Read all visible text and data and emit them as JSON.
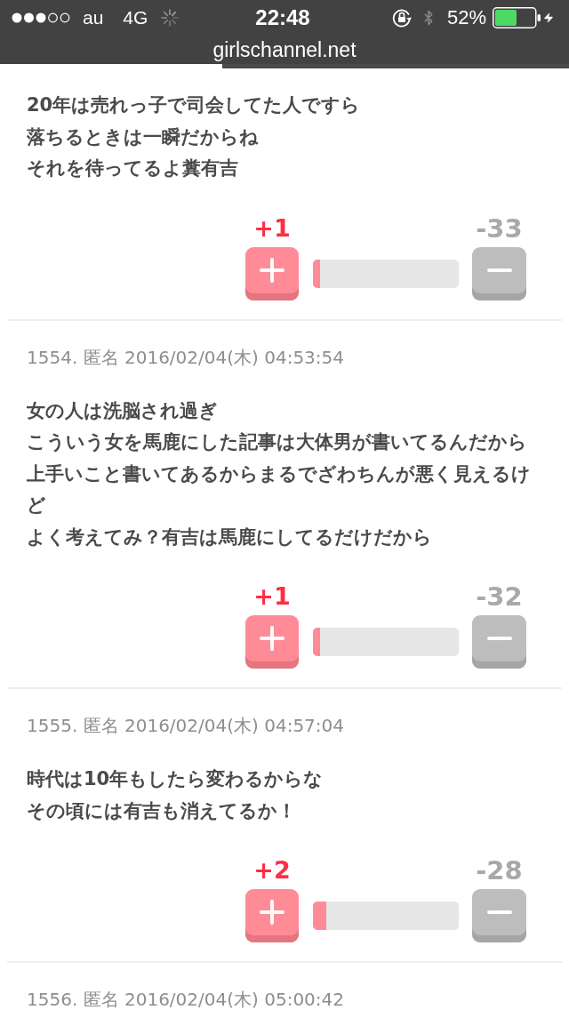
{
  "status_bar": {
    "carrier": "au",
    "network": "4G",
    "time": "22:48",
    "battery": "52%"
  },
  "address_bar": {
    "url": "girlschannel.net",
    "loading": {
      "level": 0.39
    }
  },
  "comments": [
    {
      "lines": [
        "**20**年は売れっ子で司会してた人ですら",
        "落ちるときは一瞬だからね",
        "それを待ってるよ糞有吉"
      ],
      "votes": {
        "plus": "+1",
        "minus": "-33",
        "level": 0.05
      }
    },
    {
      "meta": "1554. 匿名 2016/02/04(木) 04:53:54",
      "lines": [
        "女の人は洗脳され過ぎ",
        "こういう女を馬鹿にした記事は大体男が書いてるんだから",
        "上手いこと書いてあるからまるでざわちんが悪く見えるけど",
        "よく考えてみ？有吉は馬鹿にしてるだけだから"
      ],
      "votes": {
        "plus": "+1",
        "minus": "-32",
        "level": 0.05
      }
    },
    {
      "meta": "1555. 匿名 2016/02/04(木) 04:57:04",
      "lines": [
        "時代は**10**年もしたら変わるからな",
        "その頃には有吉も消えてるか！"
      ],
      "votes": {
        "plus": "+2",
        "minus": "-28",
        "level": 0.09
      }
    },
    {
      "meta": "1556. 匿名 2016/02/04(木) 05:00:42"
    }
  ]
}
